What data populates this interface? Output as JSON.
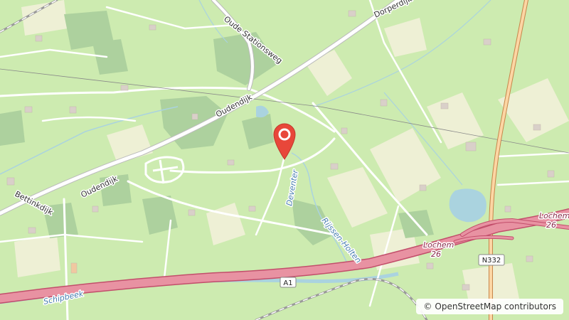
{
  "map": {
    "attribution": {
      "symbol": "©",
      "text": "OpenStreetMap contributors"
    },
    "labels": {
      "oude_stationsweg": "Oude Stationsweg",
      "dorperdijk": "Dorperdijk",
      "oudendijk_upper": "Oudendijk",
      "oudendijk_lower": "Oudendijk",
      "bettinkdijk": "Bettinkdijk",
      "deventer": "Deventer",
      "rijssen_holten": "Rijssen-Holten",
      "lochem_26_upper": "Lochem",
      "lochem_26_upper_num": "26",
      "lochem_26_lower": "Lochem",
      "lochem_26_lower_num": "26",
      "a1": "A1",
      "n332": "N332",
      "schipbeek": "Schipbeek"
    },
    "colors": {
      "farmland": "#cdebb0",
      "field": "#eef0d5",
      "forest": "#add19e",
      "water": "#aad3df",
      "motorway": "#e892a2",
      "trunk": "#f9b29c",
      "primary": "#fcd6a4",
      "road": "#ffffff",
      "marker": "#e8473a"
    },
    "icons": {
      "marker": "map-pin-icon"
    }
  }
}
